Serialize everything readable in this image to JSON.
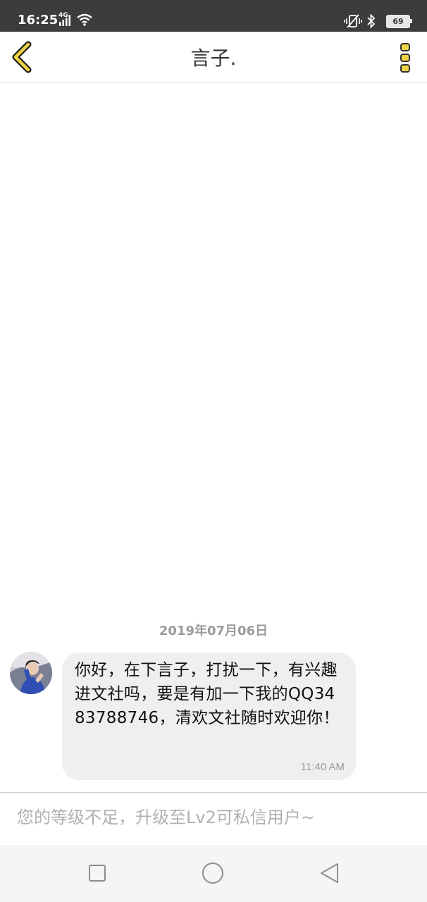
{
  "status_bar": {
    "time": "16:25",
    "network": "4G",
    "battery": "69",
    "icons": [
      "signal-icon",
      "wifi-icon",
      "vibrate-icon",
      "bluetooth-icon",
      "battery-icon"
    ]
  },
  "header": {
    "title": "言子.",
    "back_icon": "chevron-left-icon",
    "more_icon": "more-vertical-icon",
    "accent_color": "#f0d447"
  },
  "chat": {
    "date": "2019年07月06日",
    "messages": [
      {
        "sender_avatar": "avatar",
        "text": "你好，在下言子，打扰一下，有兴趣进文社吗，要是有加一下我的QQ3483788746，清欢文社随时欢迎你！",
        "time": "11:40 AM"
      }
    ]
  },
  "input": {
    "placeholder": "您的等级不足，升级至Lv2可私信用户~"
  },
  "nav_bar": {
    "buttons": [
      "recent-apps-icon",
      "home-icon",
      "back-triangle-icon"
    ]
  }
}
